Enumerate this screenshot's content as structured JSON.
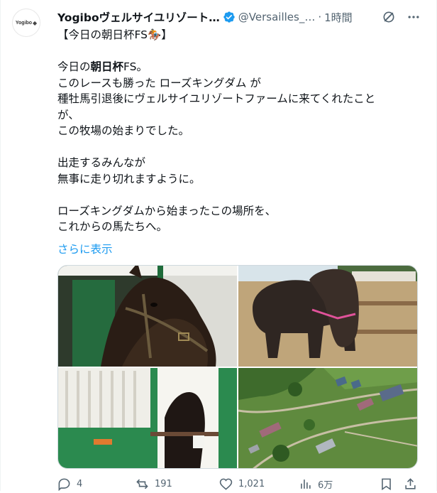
{
  "author": {
    "name": "Yogiboヴェルサイユリゾート…",
    "handle": "@Versailles_…",
    "separator": "·",
    "time": "1時間",
    "avatar_text": "Yogibo"
  },
  "tweet": {
    "line1": "【今日の朝日杯FS🏇】",
    "p1_l1_a": "今日の",
    "p1_l1_b": "朝日杯",
    "p1_l1_c": "FS。",
    "p1_l2": "このレースも勝った ローズキングダム が",
    "p1_l3": "種牡馬引退後にヴェルサイユリゾートファームに来てくれたこと",
    "p1_l4": "が、",
    "p1_l5": "この牧場の始まりでした。",
    "p2_l1": "出走するみんなが",
    "p2_l2": "無事に走り切れますように。",
    "p3_l1": "ローズキングダムから始まったこの場所を、",
    "p3_l2": "これからの馬たちへ。",
    "show_more": "さらに表示"
  },
  "media": {
    "items": [
      {
        "name": "horse-closeup-photo",
        "icon": "horse-photo"
      },
      {
        "name": "horse-paddock-photo",
        "icon": "horse-photo"
      },
      {
        "name": "horse-stable-photo",
        "icon": "stable-photo"
      },
      {
        "name": "farm-aerial-photo",
        "icon": "aerial-photo"
      }
    ]
  },
  "actions": {
    "reply_count": "4",
    "repost_count": "191",
    "like_count": "1,021",
    "view_count": "6万"
  },
  "colors": {
    "accent": "#1d9bf0",
    "muted": "#536471",
    "text": "#0f1419"
  }
}
